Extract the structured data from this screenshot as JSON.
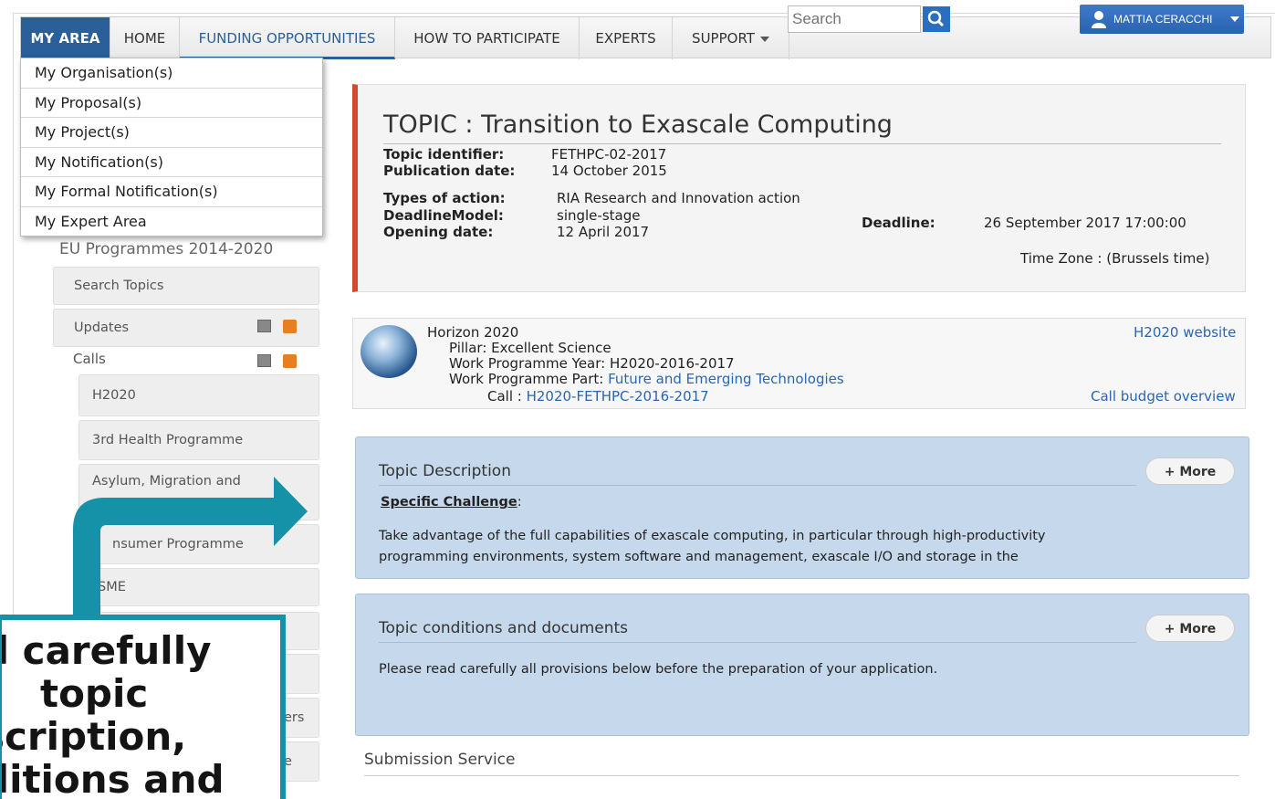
{
  "nav": {
    "tabs": [
      "MY AREA",
      "HOME",
      "FUNDING OPPORTUNITIES",
      "HOW TO PARTICIPATE",
      "EXPERTS",
      "SUPPORT"
    ],
    "search_placeholder": "Search",
    "user_name": "MATTIA CERACCHI",
    "active_color": "#2a5f99"
  },
  "my_area_menu": {
    "items": [
      "My Organisation(s)",
      "My Proposal(s)",
      "My Project(s)",
      "My Notification(s)",
      "My Formal Notification(s)",
      "My Expert Area"
    ]
  },
  "sidebar": {
    "heading": "EU Programmes 2014-2020",
    "search_topics": "Search Topics",
    "updates": "Updates",
    "calls": "Calls",
    "programmes": [
      "H2020",
      "3rd Health Programme",
      "Asylum, Migration and",
      "nsumer Programme",
      "SME",
      "ers",
      "e"
    ]
  },
  "topic": {
    "title": "TOPIC : Transition to Exascale Computing",
    "identifier_label": "Topic identifier:",
    "identifier": "FETHPC-02-2017",
    "publication_label": "Publication date:",
    "publication": "14 October 2015",
    "types_label": "Types of action:",
    "types": "RIA Research and Innovation action",
    "deadline_model_label": "DeadlineModel:",
    "deadline_model": "single-stage",
    "opening_label": "Opening date:",
    "opening": "12 April 2017",
    "deadline_label": "Deadline:",
    "deadline": "26 September 2017 17:00:00",
    "timezone": "Time Zone : (Brussels time)",
    "accent_color": "#d34a2a"
  },
  "programme": {
    "name": "Horizon 2020",
    "pillar": "Pillar: Excellent Science",
    "wp_year": "Work Programme Year: H2020-2016-2017",
    "wp_part_label": "Work Programme Part: ",
    "wp_part": "Future and Emerging Technologies",
    "call_label": "Call : ",
    "call": "H2020-FETHPC-2016-2017",
    "website_link": "H2020 website",
    "budget_link": "Call budget overview"
  },
  "description": {
    "title": "Topic Description",
    "more": "+ More",
    "challenge_heading": "Specific Challenge",
    "challenge_colon": ":",
    "text_line1": "Take advantage of the full capabilities of exascale computing, in particular through high-productivity",
    "text_line2": "programming environments, system software and management, exascale I/O and storage in the"
  },
  "conditions": {
    "title": "Topic conditions and documents",
    "more": "+ More",
    "text": "Please read carefully all provisions below before the preparation of your application."
  },
  "submission": {
    "title": "Submission Service"
  },
  "callout": {
    "lines": [
      "d carefully",
      "topic",
      "scription,",
      "ditions and"
    ],
    "border_color": "#1591a8"
  }
}
